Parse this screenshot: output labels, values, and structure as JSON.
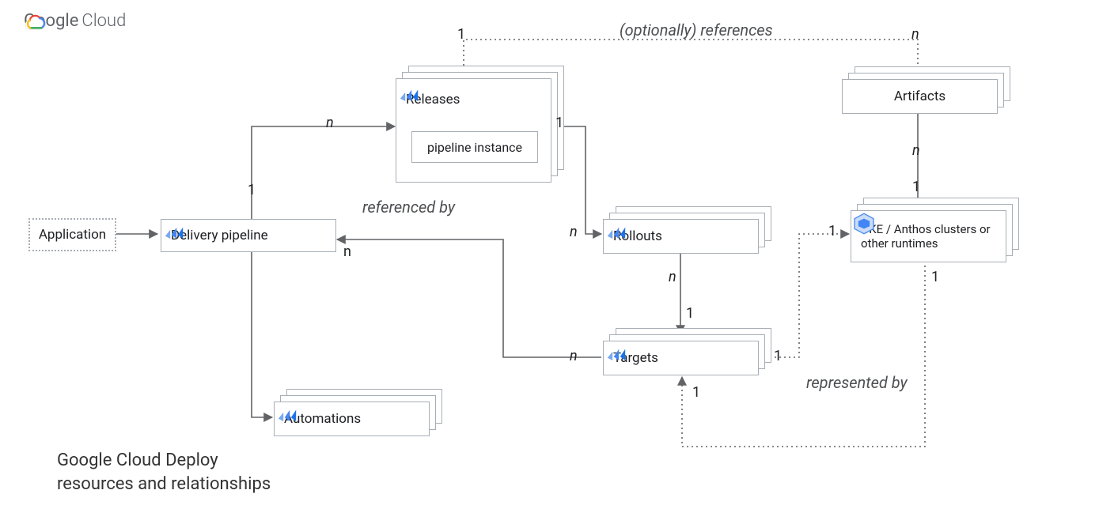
{
  "brand_google": "Google",
  "brand_cloud": "Cloud",
  "nodes": {
    "application": "Application",
    "delivery_pipeline": "Delivery pipeline",
    "releases": "Releases",
    "pipeline_instance": "pipeline instance",
    "automations": "Automations",
    "rollouts": "Rollouts",
    "targets": "Targets",
    "artifacts": "Artifacts",
    "runtimes": "GKE / Anthos clusters or other runtimes"
  },
  "edge_labels": {
    "opt_references": "(optionally) references",
    "referenced_by": "referenced by",
    "represented_by": "represented by"
  },
  "card": {
    "one": "1",
    "n": "n"
  },
  "caption_line1": "Google Cloud Deploy",
  "caption_line2": "resources and relationships"
}
